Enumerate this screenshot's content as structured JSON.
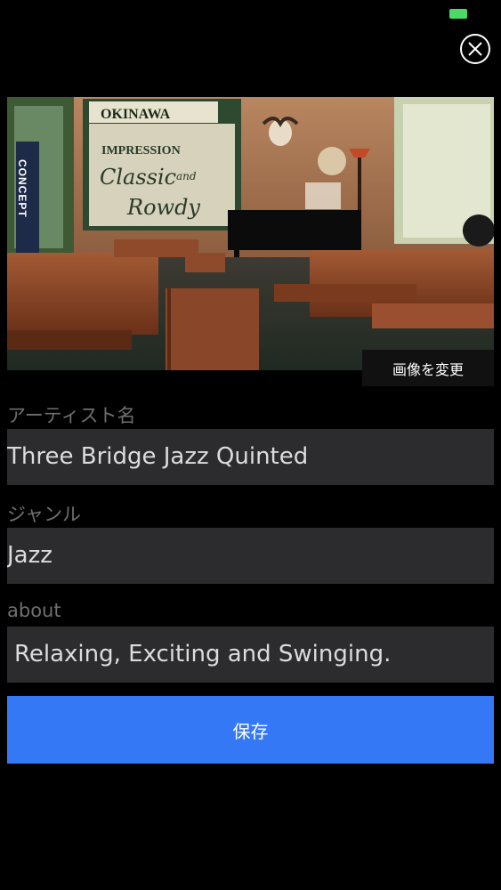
{
  "status_bar": {
    "battery_color": "#4cd964"
  },
  "header": {
    "close_icon": "close-circle-icon"
  },
  "photo": {
    "sign_okinawa": "OKINAWA",
    "sign_concept": "CONCEPT",
    "sign_impression": "IMPRESSION",
    "sign_classic": "Classic",
    "sign_and": "and",
    "sign_rowdy": "Rowdy",
    "change_label": "画像を変更"
  },
  "form": {
    "artist": {
      "label": "アーティスト名",
      "value": "Three Bridge Jazz Quinted"
    },
    "genre": {
      "label": "ジャンル",
      "value": "Jazz"
    },
    "about": {
      "label": "about",
      "value": "Relaxing, Exciting and Swinging."
    }
  },
  "save_label": "保存",
  "colors": {
    "accent": "#3478f6",
    "field_bg": "#2c2c2e",
    "label": "#6f6f6f"
  }
}
